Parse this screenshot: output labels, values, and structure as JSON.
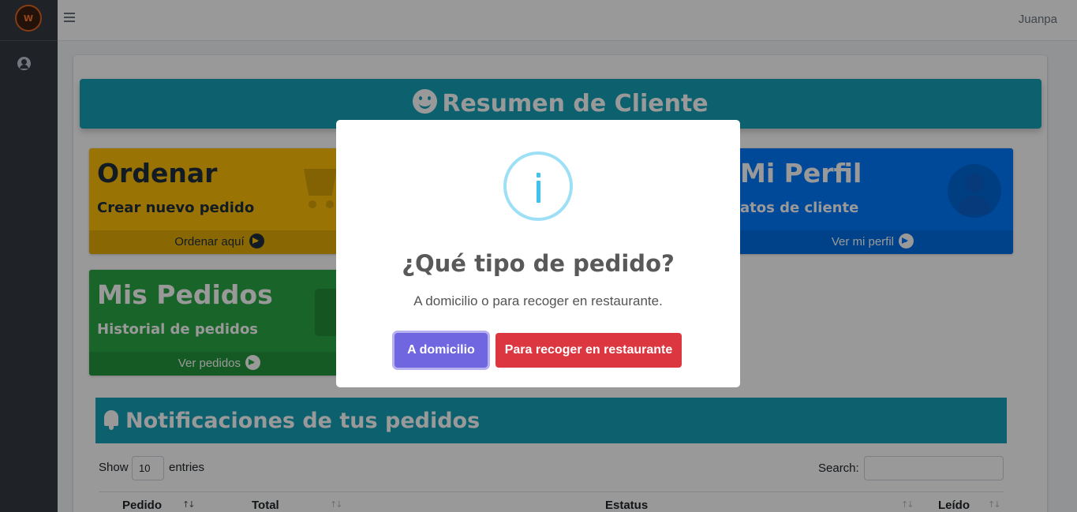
{
  "topbar": {
    "username": "Juanpa"
  },
  "sidebar": {
    "logo_text": "W"
  },
  "banner": {
    "title": "Resumen de Cliente"
  },
  "cards": {
    "ordenar": {
      "title": "Ordenar",
      "subtitle": "Crear nuevo pedido",
      "link": "Ordenar aquí"
    },
    "perfil": {
      "title": "Mi Perfil",
      "subtitle": "atos de cliente",
      "link": "Ver mi perfil"
    },
    "pedidos": {
      "title": "Mis Pedidos",
      "subtitle": "Historial de pedidos",
      "link": "Ver pedidos"
    }
  },
  "notifications": {
    "title": "Notificaciones de tus pedidos"
  },
  "datatable": {
    "show_label": "Show",
    "entries_value": "10",
    "entries_label": "entries",
    "search_label": "Search:",
    "columns": [
      "Pedido",
      "Total",
      "Estatus",
      "Leído"
    ]
  },
  "modal": {
    "icon": "info-icon",
    "title": "¿Qué tipo de pedido?",
    "text": "A domicilio o para recoger en restaurante.",
    "confirm_label": "A domicilio",
    "deny_label": "Para recoger en restaurante"
  },
  "colors": {
    "sidebar": "#343a40",
    "info": "#17a2b8",
    "warning": "#ffc107",
    "primary": "#007bff",
    "success": "#28a745",
    "confirm": "#7066e0",
    "deny": "#dc3741"
  }
}
